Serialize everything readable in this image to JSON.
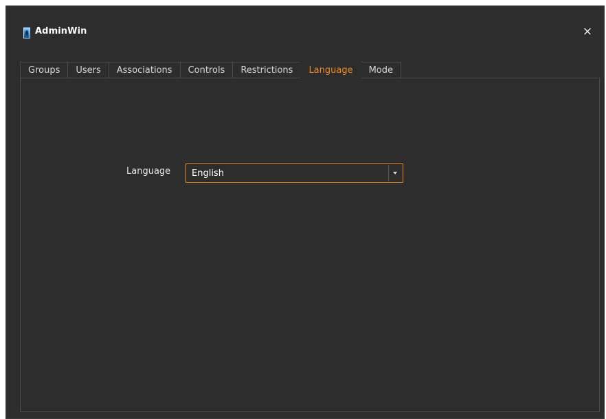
{
  "window": {
    "title": "AdminWin",
    "close_label": "×"
  },
  "tabs": [
    {
      "label": "Groups",
      "selected": false
    },
    {
      "label": "Users",
      "selected": false
    },
    {
      "label": "Associations",
      "selected": false
    },
    {
      "label": "Controls",
      "selected": false
    },
    {
      "label": "Restrictions",
      "selected": false
    },
    {
      "label": "Language",
      "selected": true
    },
    {
      "label": "Mode",
      "selected": false
    }
  ],
  "language_panel": {
    "label": "Language",
    "selected_value": "English"
  },
  "colors": {
    "background": "#2d2d2d",
    "accent": "#f08c1b",
    "text": "#e8e8e8",
    "border": "#4b4b4b"
  },
  "icons": {
    "app_icon": "app-icon",
    "close_icon": "close-icon",
    "dropdown_icon": "chevron-down-icon"
  }
}
